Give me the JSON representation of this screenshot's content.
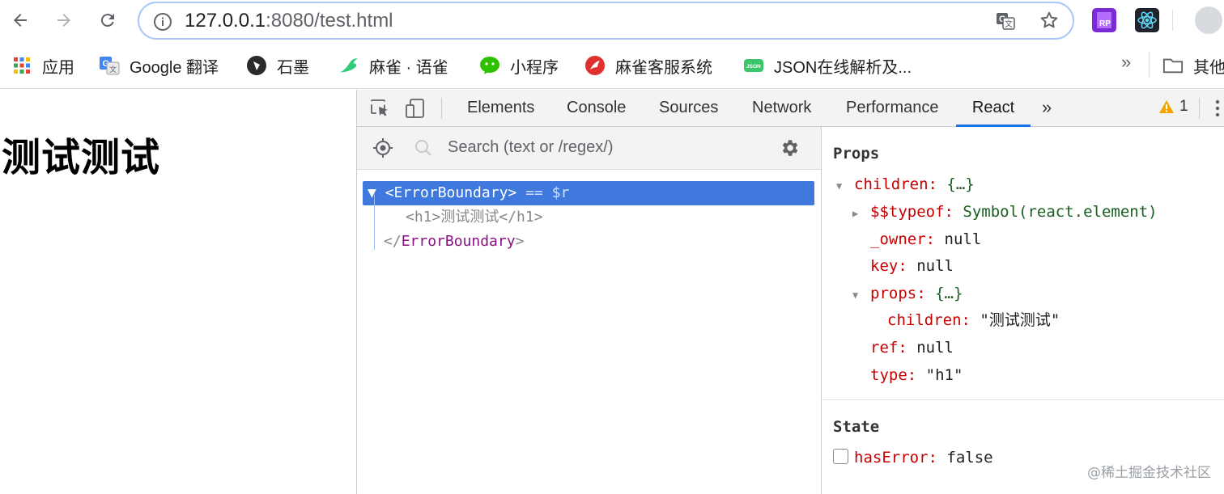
{
  "browser": {
    "url_host": "127.0.0.1",
    "url_rest": ":8080/test.html",
    "back_icon": "back-arrow-icon",
    "forward_icon": "forward-arrow-icon",
    "reload_icon": "reload-icon"
  },
  "bookmarks": {
    "items": [
      {
        "label": "应用",
        "icon": "apps-grid-icon"
      },
      {
        "label": "Google 翻译",
        "icon": "google-translate-icon"
      },
      {
        "label": "石墨",
        "icon": "shimo-icon"
      },
      {
        "label": "麻雀 · 语雀",
        "icon": "yuque-icon"
      },
      {
        "label": "小程序",
        "icon": "wechat-miniprogram-icon"
      },
      {
        "label": "麻雀客服系统",
        "icon": "customer-service-icon"
      },
      {
        "label": "JSON在线解析及...",
        "icon": "json-icon"
      }
    ],
    "more": "»",
    "other_label": "其他"
  },
  "page": {
    "heading": "测试测试"
  },
  "devtools": {
    "tabs": [
      "Elements",
      "Console",
      "Sources",
      "Network",
      "Performance",
      "React"
    ],
    "active_tab": "React",
    "more_tabs": "»",
    "warning_count": "1",
    "search_placeholder": "Search (text or /regex/)",
    "tree": {
      "root_open": "<ErrorBoundary>",
      "root_suffix": "== $r",
      "child": "<h1>测试测试</h1>",
      "root_close_open": "</",
      "root_close_name": "ErrorBoundary",
      "root_close_end": ">"
    },
    "props": {
      "title": "Props",
      "children_key": "children:",
      "children_val": "{…}",
      "typeof_key": "$$typeof:",
      "typeof_val": "Symbol(react.element)",
      "owner_key": "_owner:",
      "owner_val": "null",
      "key_key": "key:",
      "key_val": "null",
      "props_key": "props:",
      "props_val": "{…}",
      "inner_children_key": "children:",
      "inner_children_val": "\"测试测试\"",
      "ref_key": "ref:",
      "ref_val": "null",
      "type_key": "type:",
      "type_val": "\"h1\""
    },
    "state": {
      "title": "State",
      "haserror_key": "hasError:",
      "haserror_val": "false"
    }
  },
  "watermark": "@稀土掘金技术社区"
}
